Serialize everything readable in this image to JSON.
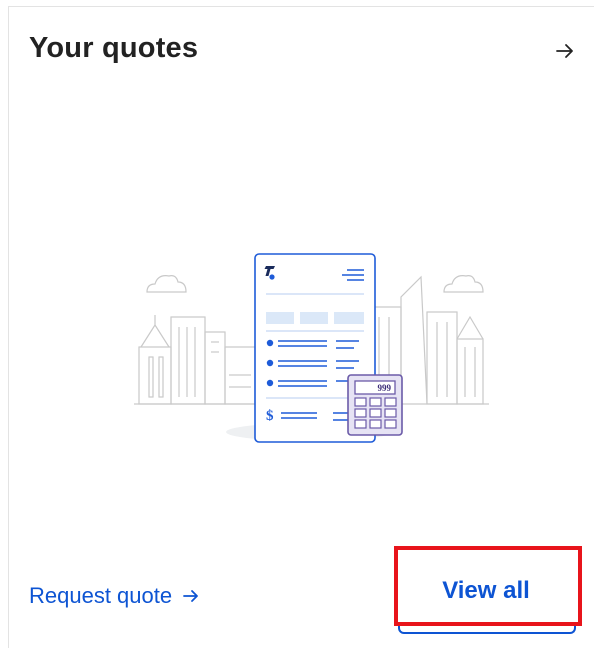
{
  "card": {
    "title": "Your quotes",
    "header_icon": "arrow-right-icon"
  },
  "illustration": {
    "calculator_display": "999",
    "currency_symbol": "$",
    "brand_icon": "telstra-logo-icon"
  },
  "actions": {
    "request_quote_label": "Request quote",
    "view_all_label": "View all"
  },
  "colors": {
    "accent": "#0d54d3",
    "highlight": "#e8141b",
    "calculator": "#6b5ba8",
    "calculator_fill": "#e6e3f4",
    "document_tint": "#dbe8f8"
  }
}
